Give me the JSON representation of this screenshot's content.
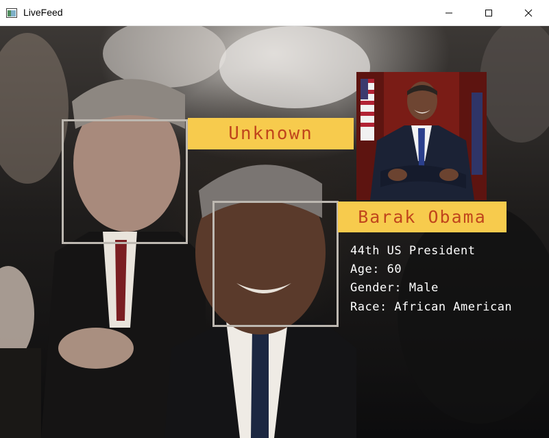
{
  "window": {
    "title": "LiveFeed",
    "icon": "app-window-icon"
  },
  "controls": {
    "minimize_icon": "minimize-icon",
    "maximize_icon": "maximize-icon",
    "close_icon": "close-icon"
  },
  "detections": {
    "unknown_label": "Unknown",
    "identified_label": "Barak Obama"
  },
  "profile": {
    "line1": "44th US President",
    "line2": "Age: 60",
    "line3": "Gender: Male",
    "line4": "Race: African American"
  },
  "colors": {
    "label_bg": "#f7cb4d",
    "label_text": "#c0451c",
    "box_border": "#bdb8b1",
    "info_text": "#ffffff"
  }
}
